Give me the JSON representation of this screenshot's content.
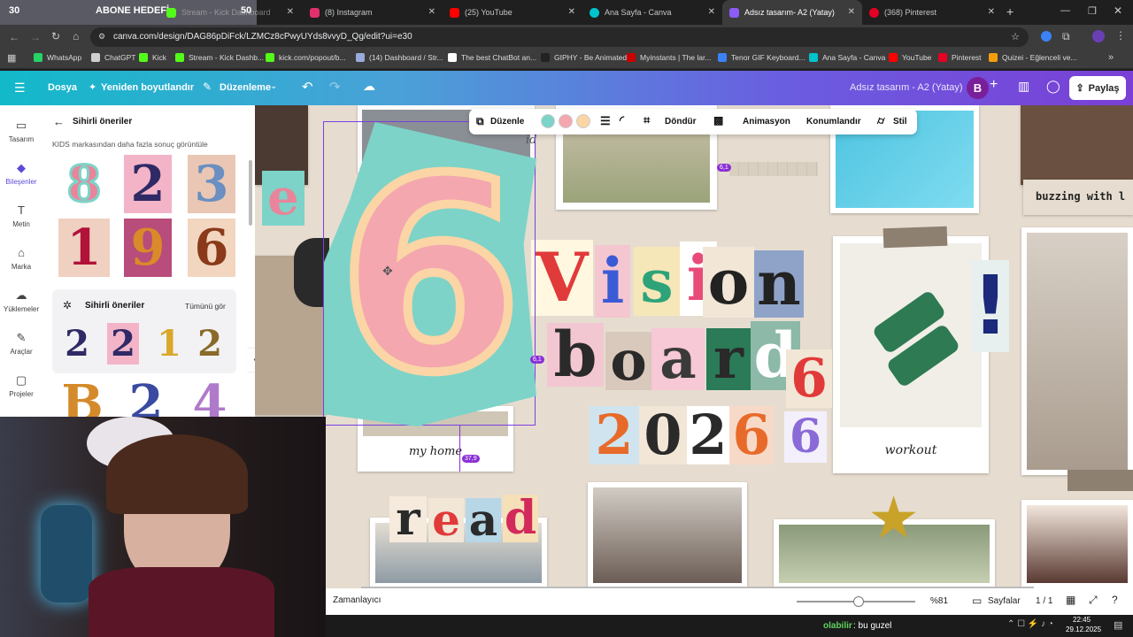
{
  "browser": {
    "overlay": {
      "count_left": "30",
      "label": "ABONE HEDEFİ",
      "count_right": "50"
    },
    "tabs": [
      {
        "title": "Stream - Kick Dashboard",
        "color": "#53fc18"
      },
      {
        "title": "(8) Instagram",
        "color": "#e1306c"
      },
      {
        "title": "(25) YouTube",
        "color": "#ff0000"
      },
      {
        "title": "Ana Sayfa - Canva",
        "color": "#00c4cc"
      },
      {
        "title": "Adsız tasarım- A2 (Yatay)",
        "color": "#8b5cf6"
      },
      {
        "title": "(368) Pinterest",
        "color": "#e60023"
      }
    ],
    "url": "canva.com/design/DAG86pDiFck/LZMCz8cPwyUYds8vvyD_Qg/edit?ui=e30",
    "bookmarks": [
      {
        "label": "WhatsApp",
        "color": "#25d366"
      },
      {
        "label": "ChatGPT",
        "color": "#cfcfcf"
      },
      {
        "label": "Kick",
        "color": "#53fc18"
      },
      {
        "label": "Stream - Kick Dashb...",
        "color": "#53fc18"
      },
      {
        "label": "kick.com/popout/b...",
        "color": "#53fc18"
      },
      {
        "label": "(14) Dashboard / Str...",
        "color": "#9ad"
      },
      {
        "label": "The best ChatBot an...",
        "color": "#fff"
      },
      {
        "label": "GIPHY - Be Animated",
        "color": "#222"
      },
      {
        "label": "Myinstants | The lar...",
        "color": "#c00"
      },
      {
        "label": "Tenor GIF Keyboard...",
        "color": "#3b82f6"
      },
      {
        "label": "Ana Sayfa - Canva",
        "color": "#00c4cc"
      },
      {
        "label": "YouTube",
        "color": "#ff0000"
      },
      {
        "label": "Pinterest",
        "color": "#e60023"
      },
      {
        "label": "Quizei - Eğlenceli ve...",
        "color": "#f59e0b"
      }
    ]
  },
  "canva": {
    "header": {
      "file": "Dosya",
      "resize": "Yeniden boyutlandır",
      "edit": "Düzenleme",
      "doc_title": "Adsız tasarım - A2 (Yatay)",
      "avatar": "B",
      "share": "Paylaş"
    },
    "rail": [
      {
        "label": "Tasarım",
        "icon": "layout-icon"
      },
      {
        "label": "Bileşenler",
        "icon": "elements-icon"
      },
      {
        "label": "Metin",
        "icon": "text-icon"
      },
      {
        "label": "Marka",
        "icon": "brand-icon"
      },
      {
        "label": "Yüklemeler",
        "icon": "upload-icon"
      },
      {
        "label": "Araçlar",
        "icon": "tools-icon"
      },
      {
        "label": "Projeler",
        "icon": "folder-icon"
      }
    ],
    "panel": {
      "title": "Sihirli öneriler",
      "subtitle": "KIDS markasından daha fazla sonuç görüntüle",
      "tiles": [
        "8",
        "2",
        "3",
        "1",
        "9",
        "6"
      ],
      "magic_title": "Sihirli öneriler",
      "see_all": "Tümünü gör",
      "magic_tiles": [
        "2",
        "2",
        "1",
        "2"
      ],
      "bottom_tiles": [
        "B",
        "2",
        "4"
      ]
    },
    "toolbar": {
      "edit": "Düzenle",
      "colors": [
        "#7dd3c8",
        "#f4a7ae",
        "#fbd5a5"
      ],
      "rotate": "Döndür",
      "animate": "Animasyon",
      "position": "Konumlandır",
      "style": "Stil"
    },
    "canvas": {
      "selected_glyph": "6",
      "badge_a": "6,1",
      "badge_b": "6,1",
      "badge_c": "37,9",
      "vision": [
        "V",
        "i",
        "s",
        "i",
        "o",
        "n"
      ],
      "board": [
        "b",
        "o",
        "a",
        "r",
        "d",
        "6"
      ],
      "year": [
        "2",
        "0",
        "2",
        "6"
      ],
      "six_small": "6",
      "read": [
        "r",
        "e",
        "a",
        "d"
      ],
      "exclaim": "!",
      "e_tile": "e",
      "caption_home": "my home",
      "caption_workout": "workout",
      "buzzing": "buzzing with l",
      "tape_text": "id"
    },
    "bottom": {
      "timeline": "Zamanlayıcı",
      "zoom": "%81",
      "pages": "Sayfalar",
      "page_count": "1 / 1"
    }
  },
  "chat": {
    "user": "olabilir",
    "message": ": bu guzel"
  },
  "taskbar": {
    "time": "22:45",
    "date": "29.12.2025"
  }
}
